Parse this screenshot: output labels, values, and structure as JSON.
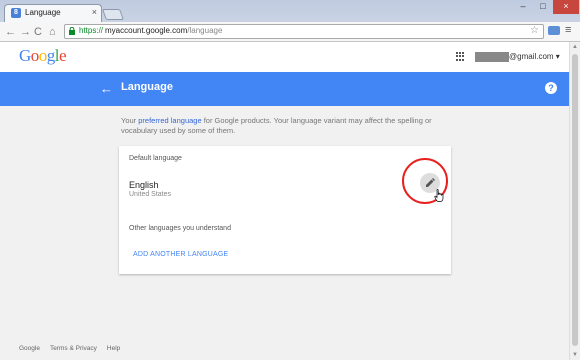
{
  "browser": {
    "tab_title": "Language",
    "tab_favicon": "8",
    "url_scheme": "https://",
    "url_host": "myaccount.google.com",
    "url_path": "/language",
    "close_label": "×",
    "min_label": "–",
    "max_label": "□",
    "winclose_label": "×"
  },
  "header": {
    "logo": "Google",
    "logo_colors": [
      "#4285f4",
      "#ea4335",
      "#fbbc05",
      "#4285f4",
      "#34a853",
      "#ea4335"
    ],
    "email_suffix": "@gmail.com ▾"
  },
  "bar": {
    "title": "Language",
    "help": "?",
    "color": "#4285f4"
  },
  "intro": {
    "before": "Your ",
    "link": "preferred language",
    "after": " for Google products. Your language variant may affect the spelling or vocabulary used by some of them."
  },
  "card": {
    "default_label": "Default language",
    "lang_name": "English",
    "lang_region": "United States",
    "other_label": "Other languages you understand",
    "add_label": "ADD ANOTHER LANGUAGE"
  },
  "footer": {
    "items": [
      "Google",
      "Terms & Privacy",
      "Help"
    ]
  }
}
